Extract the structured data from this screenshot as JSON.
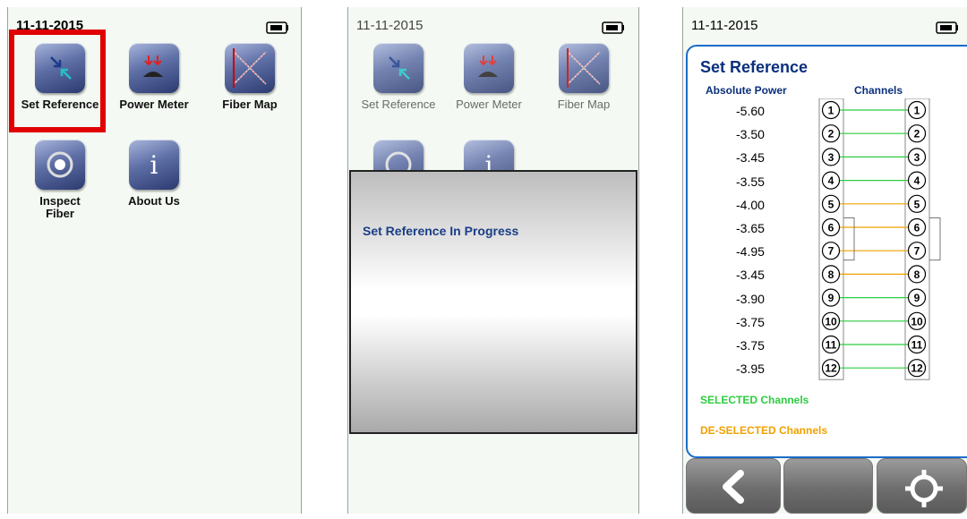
{
  "screen1": {
    "date": "11-11-2015",
    "apps": [
      {
        "label": "Set Reference",
        "icon": "set-reference-icon"
      },
      {
        "label": "Power Meter",
        "icon": "power-meter-icon"
      },
      {
        "label": "Fiber Map",
        "icon": "fiber-map-icon"
      },
      {
        "label": "Inspect\nFiber",
        "icon": "inspect-fiber-icon"
      },
      {
        "label": "About Us",
        "icon": "info-icon"
      }
    ]
  },
  "screen2": {
    "date": "11-11-2015",
    "apps": [
      {
        "label": "Set Reference",
        "icon": "set-reference-icon"
      },
      {
        "label": "Power Meter",
        "icon": "power-meter-icon"
      },
      {
        "label": "Fiber Map",
        "icon": "fiber-map-icon"
      }
    ],
    "dialog_message": "Set Reference In Progress"
  },
  "screen3": {
    "date": "11-11-2015",
    "title": "Set Reference",
    "col_power": "Absolute Power",
    "col_channels": "Channels",
    "channels": [
      {
        "num": "1",
        "power": "-5.60",
        "selected": true
      },
      {
        "num": "2",
        "power": "-3.50",
        "selected": true
      },
      {
        "num": "3",
        "power": "-3.45",
        "selected": true
      },
      {
        "num": "4",
        "power": "-3.55",
        "selected": true
      },
      {
        "num": "5",
        "power": "-4.00",
        "selected": false
      },
      {
        "num": "6",
        "power": "-3.65",
        "selected": false
      },
      {
        "num": "7",
        "power": "-4.95",
        "selected": false
      },
      {
        "num": "8",
        "power": "-3.45",
        "selected": false
      },
      {
        "num": "9",
        "power": "-3.90",
        "selected": true
      },
      {
        "num": "10",
        "power": "-3.75",
        "selected": true
      },
      {
        "num": "11",
        "power": "-3.75",
        "selected": true
      },
      {
        "num": "12",
        "power": "-3.95",
        "selected": true
      }
    ],
    "legend_selected": "SELECTED Channels",
    "legend_deselected": "DE-SELECTED Channels",
    "buttons": [
      "back-arrow-icon",
      "blank",
      "target-icon"
    ]
  },
  "colors": {
    "selected": "#2ecc40",
    "deselected": "#f0a000",
    "title": "#0a2f7c",
    "highlight": "#e00000"
  }
}
